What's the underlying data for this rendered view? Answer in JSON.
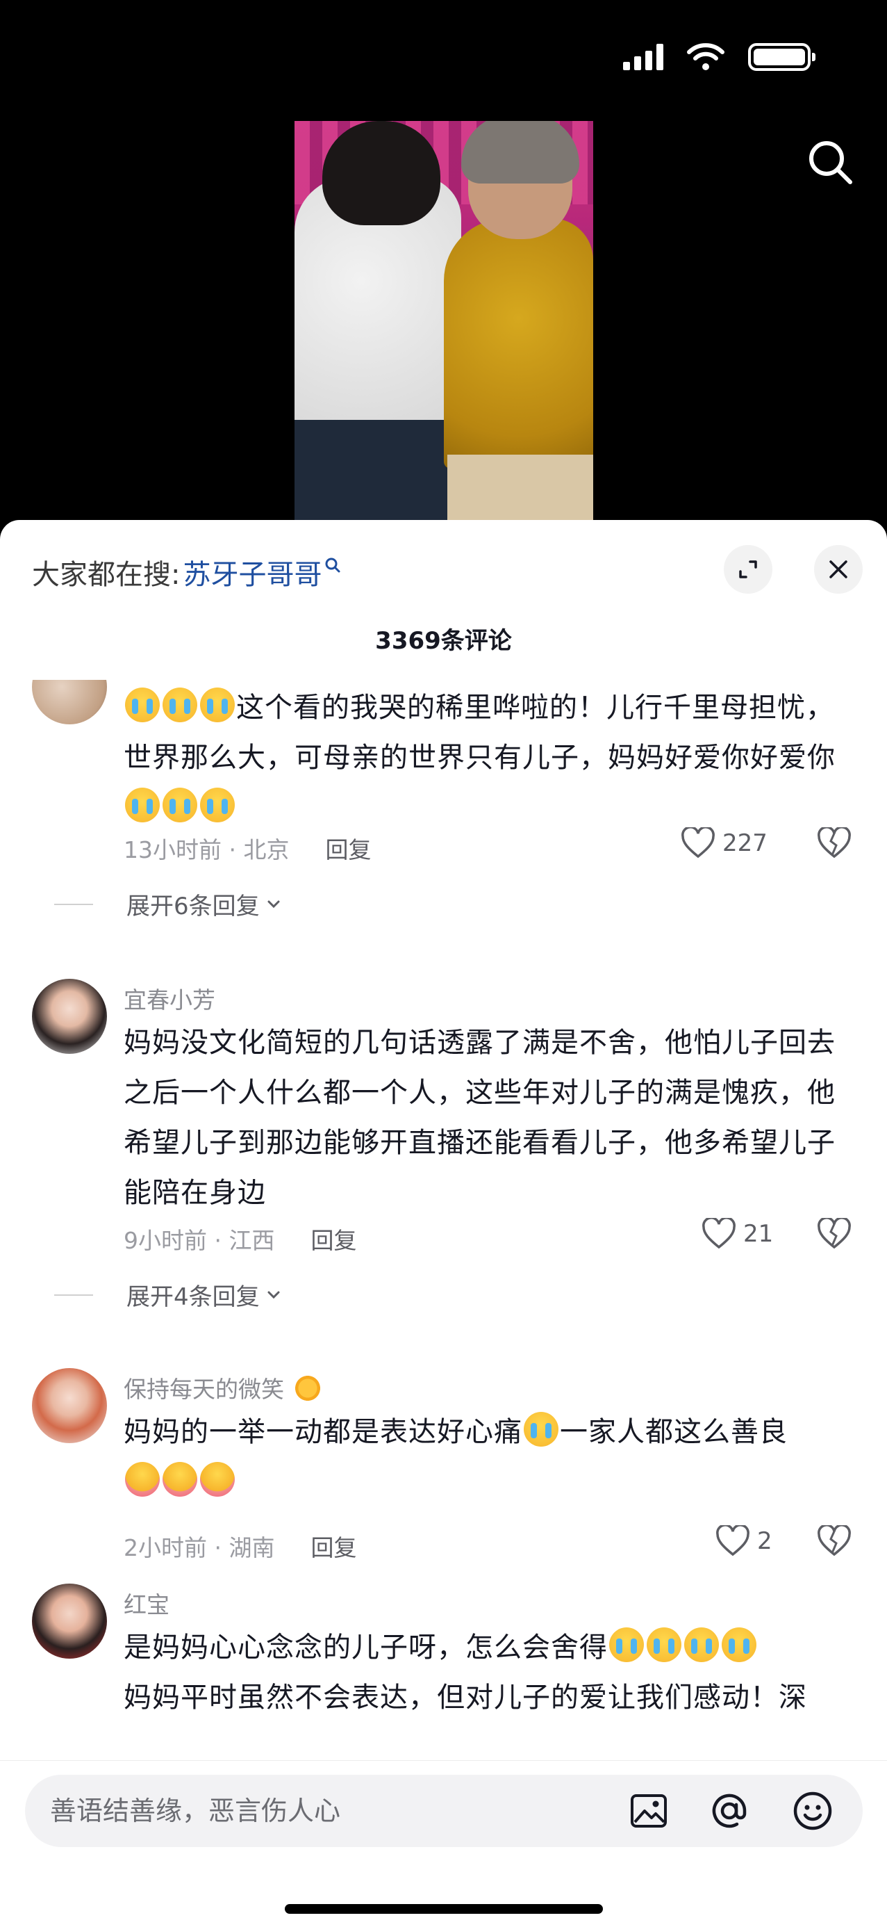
{
  "status_bar": {
    "icons": [
      "signal-icon",
      "wifi-icon",
      "battery-icon"
    ]
  },
  "video": {
    "description_icon": "video-frame"
  },
  "sheet": {
    "hot_search_prefix": "大家都在搜:",
    "hot_search_term": "苏牙子哥哥",
    "comment_count": "3369条评论"
  },
  "comments": [
    {
      "username": "",
      "text_parts": [
        "这个看的我哭的稀里哗啦的！儿行千里母担忧，世界那么大，可母亲的世界只有儿子，妈妈好爱你好爱你"
      ],
      "time_location": "13小时前 · 北京",
      "reply_label": "回复",
      "likes": "227",
      "expand_label": "展开6条回复"
    },
    {
      "username": "宜春小芳",
      "text": "妈妈没文化简短的几句话透露了满是不舍，他怕儿子回去之后一个人什么都一个人，这些年对儿子的满是愧疚，他希望儿子到那边能够开直播还能看看儿子，他多希望儿子能陪在身边",
      "time_location": "9小时前 · 江西",
      "reply_label": "回复",
      "likes": "21",
      "expand_label": "展开4条回复"
    },
    {
      "username": "保持每天的微笑",
      "text_a": "妈妈的一举一动都是表达好心痛",
      "text_b": "一家人都这么善良",
      "time_location": "2小时前 · 湖南",
      "reply_label": "回复",
      "likes": "2"
    },
    {
      "username": "红宝",
      "text_a": "是妈妈心心念念的儿子呀，怎么会舍得",
      "text_b": "妈妈平时虽然不会表达，但对儿子的爱让我们感动！深"
    }
  ],
  "input": {
    "placeholder": "善语结善缘，恶言伤人心"
  },
  "colors": {
    "link_blue": "#1f4fa0",
    "sheet_bg": "#ffffff",
    "video_bg": "#000000"
  }
}
